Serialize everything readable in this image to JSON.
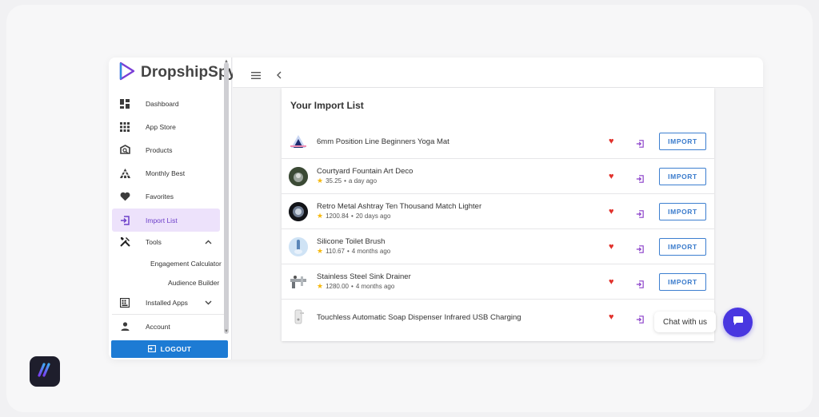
{
  "app": {
    "logo_text": "DropshipSpy"
  },
  "sidebar": {
    "items": [
      {
        "label": "Dashboard",
        "icon": "dashboard-icon"
      },
      {
        "label": "App Store",
        "icon": "grid-apps-icon"
      },
      {
        "label": "Products",
        "icon": "products-icon"
      },
      {
        "label": "Monthly Best",
        "icon": "pyramid-icon"
      },
      {
        "label": "Favorites",
        "icon": "heart-icon"
      },
      {
        "label": "Import List",
        "icon": "import-icon",
        "active": true
      },
      {
        "label": "Tools",
        "icon": "tools-icon",
        "expanded": true
      },
      {
        "label": "Installed Apps",
        "icon": "installed-apps-icon",
        "expanded": false
      },
      {
        "label": "Account",
        "icon": "account-icon"
      }
    ],
    "tools_subitems": [
      "Engagement Calculator",
      "Audience Builder"
    ],
    "logout_label": "LOGOUT"
  },
  "main": {
    "title": "Your Import List",
    "import_label": "IMPORT",
    "products": [
      {
        "name": "6mm Position Line Beginners Yoga Mat",
        "rating": "",
        "age": ""
      },
      {
        "name": "Courtyard Fountain Art Deco",
        "rating": "35.25",
        "age": "a day ago"
      },
      {
        "name": "Retro Metal Ashtray Ten Thousand Match Lighter",
        "rating": "1200.84",
        "age": "20 days ago"
      },
      {
        "name": "Silicone Toilet Brush",
        "rating": "110.67",
        "age": "4 months ago"
      },
      {
        "name": "Stainless Steel Sink Drainer",
        "rating": "1280.00",
        "age": "4 months ago"
      },
      {
        "name": "Touchless Automatic Soap Dispenser Infrared USB Charging",
        "rating": "",
        "age": ""
      }
    ]
  },
  "chat": {
    "label": "Chat with us"
  },
  "colors": {
    "accent": "#6d3fc9",
    "active_bg": "#ede2fb",
    "primary": "#1d7bd4",
    "heart": "#e1322c",
    "chat": "#4937e0"
  }
}
